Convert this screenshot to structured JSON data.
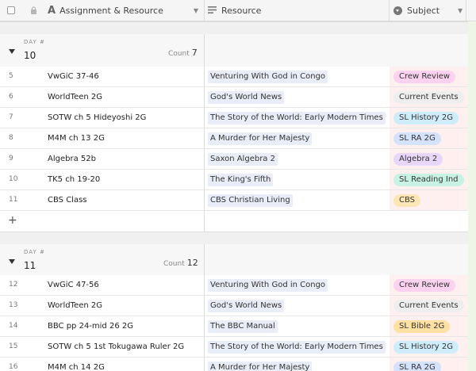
{
  "columns": {
    "assignment": {
      "label": "Assignment & Resource",
      "type_icon": "formula-A-icon"
    },
    "resource": {
      "label": "Resource",
      "type_icon": "link-list-icon"
    },
    "subject": {
      "label": "Subject",
      "type_icon": "select-circle-icon"
    }
  },
  "colors": {
    "crew_review": "#fbd3f0",
    "current_events": "#eeeeee",
    "sl_history": "#cfecfb",
    "sl_ra": "#d4e2fb",
    "algebra": "#e8d7fa",
    "sl_reading": "#c8f2e3",
    "cbs": "#fde6b6",
    "sl_bible": "#fde0a3"
  },
  "groups": [
    {
      "label": "DAY #",
      "value": "10",
      "count_label": "Count",
      "count": "7",
      "rows": [
        {
          "num": "5",
          "name": "VwGiC 37-46",
          "resource": "Venturing With God in Congo",
          "subject": "Crew Review",
          "color": "#fbd3f0"
        },
        {
          "num": "6",
          "name": "WorldTeen 2G",
          "resource": "God's World News",
          "subject": "Current Events",
          "color": "#eeeeee"
        },
        {
          "num": "7",
          "name": "SOTW ch 5 Hideyoshi 2G",
          "resource": "The Story of the World: Early Modern Times",
          "subject": "SL History 2G",
          "color": "#cfecfb"
        },
        {
          "num": "8",
          "name": "M4M ch 13 2G",
          "resource": "A Murder for Her Majesty",
          "subject": "SL RA 2G",
          "color": "#d4e2fb"
        },
        {
          "num": "9",
          "name": "Algebra 52b",
          "resource": "Saxon Algebra 2",
          "subject": "Algebra 2",
          "color": "#e8d7fa"
        },
        {
          "num": "10",
          "name": "TK5 ch 19-20",
          "resource": "The King's Fifth",
          "subject": "SL Reading Ind",
          "color": "#c8f2e3"
        },
        {
          "num": "11",
          "name": "CBS Class",
          "resource": "CBS Christian Living",
          "subject": "CBS",
          "color": "#fde6b6"
        }
      ]
    },
    {
      "label": "DAY #",
      "value": "11",
      "count_label": "Count",
      "count": "12",
      "rows": [
        {
          "num": "12",
          "name": "VwGiC 47-56",
          "resource": "Venturing With God in Congo",
          "subject": "Crew Review",
          "color": "#fbd3f0"
        },
        {
          "num": "13",
          "name": "WorldTeen 2G",
          "resource": "God's World News",
          "subject": "Current Events",
          "color": "#eeeeee"
        },
        {
          "num": "14",
          "name": "BBC pp 24-mid 26 2G",
          "resource": "The BBC Manual",
          "subject": "SL Bible 2G",
          "color": "#fde0a3"
        },
        {
          "num": "15",
          "name": "SOTW ch 5 1st Tokugawa Ruler 2G",
          "resource": "The Story of the World: Early Modern Times",
          "subject": "SL History 2G",
          "color": "#cfecfb"
        },
        {
          "num": "16",
          "name": "M4M ch 14 2G",
          "resource": "A Murder for Her Majesty",
          "subject": "SL RA 2G",
          "color": "#d4e2fb"
        }
      ]
    }
  ],
  "add_row_symbol": "+"
}
